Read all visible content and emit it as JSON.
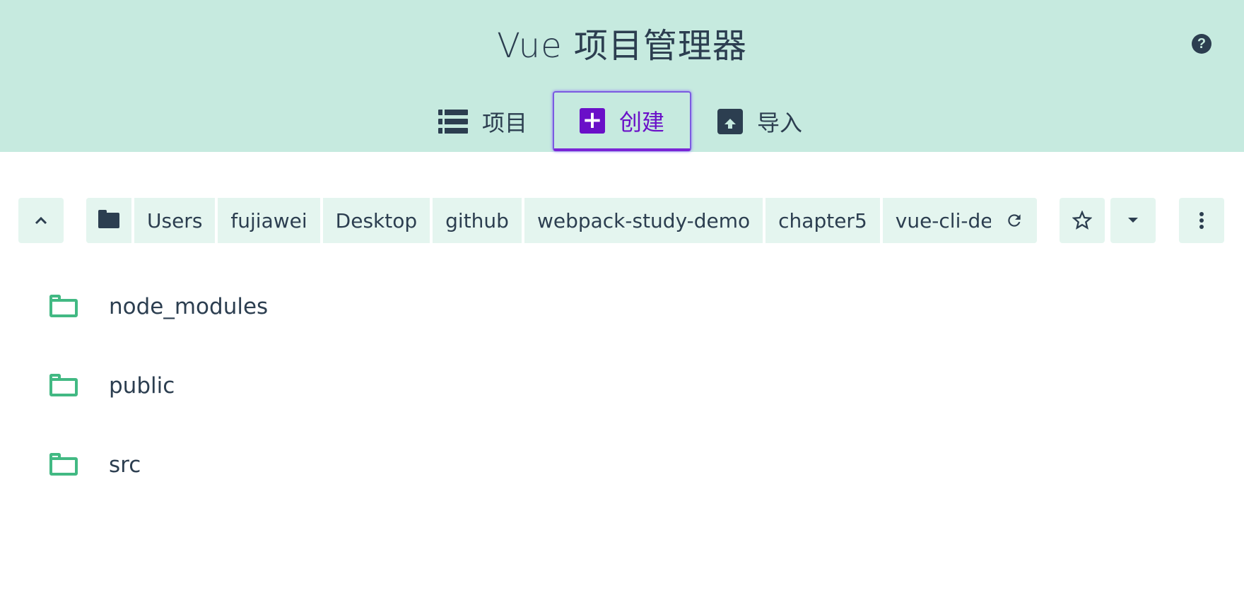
{
  "header": {
    "title": "Vue 项目管理器",
    "help_icon": "help-circle-icon",
    "tabs": [
      {
        "label": "项目",
        "icon": "list-icon",
        "active": false
      },
      {
        "label": "创建",
        "icon": "plus-box-icon",
        "active": true
      },
      {
        "label": "导入",
        "icon": "unarchive-icon",
        "active": false
      }
    ]
  },
  "pathbar": {
    "up_icon": "chevron-up-icon",
    "folder_icon": "folder-icon",
    "crumbs": [
      "Users",
      "fujiawei",
      "Desktop",
      "github",
      "webpack-study-demo",
      "chapter5",
      "vue-cli-dem"
    ],
    "edit_icon": "pencil-icon",
    "refresh_icon": "refresh-icon",
    "favorite_icon": "star-icon",
    "dropdown_icon": "caret-down-icon",
    "more_icon": "more-vert-icon"
  },
  "folders": [
    {
      "name": "node_modules"
    },
    {
      "name": "public"
    },
    {
      "name": "src"
    }
  ],
  "colors": {
    "header_bg": "#c6eadf",
    "accent": "#6a10c8",
    "folder_green": "#42b983",
    "text": "#2c3e50",
    "button_bg": "#e4f5ef"
  }
}
